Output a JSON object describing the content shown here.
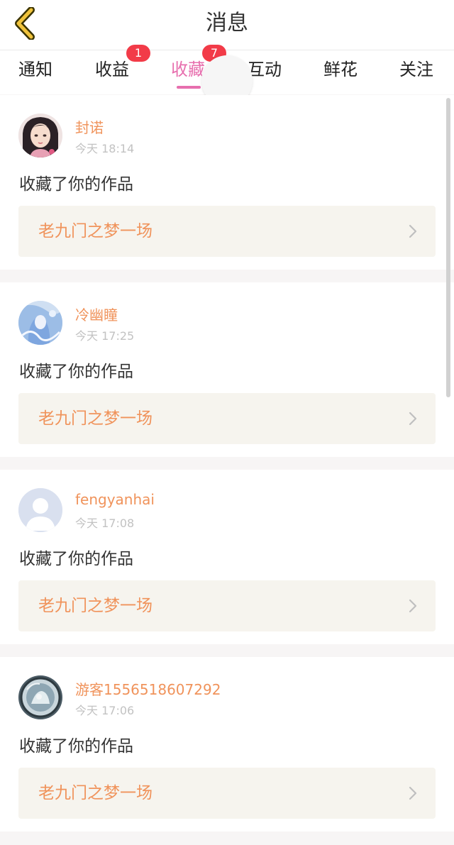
{
  "header": {
    "title": "消息",
    "back_icon": "chevron-left-icon",
    "back_icon_color": "#f0c33c"
  },
  "tabs": [
    {
      "label": "通知",
      "badge": ""
    },
    {
      "label": "收益",
      "badge": "1"
    },
    {
      "label": "收藏",
      "badge": "7",
      "active": true
    },
    {
      "label": "互动",
      "badge": ""
    },
    {
      "label": "鲜花",
      "badge": ""
    },
    {
      "label": "关注",
      "badge": ""
    }
  ],
  "colors": {
    "accent_pink": "#e76fae",
    "badge_red": "#f23b48",
    "name_orange": "#f0935b",
    "card_bg": "#f6f4ee"
  },
  "messages": [
    {
      "username": "封诺",
      "time": "今天 18:14",
      "action": "收藏了你的作品",
      "work_title": "老九门之梦一场",
      "avatar": "avatar-girl"
    },
    {
      "username": "冷幽瞳",
      "time": "今天 17:25",
      "action": "收藏了你的作品",
      "work_title": "老九门之梦一场",
      "avatar": "avatar-anime-blue"
    },
    {
      "username": "fengyanhai",
      "time": "今天 17:08",
      "action": "收藏了你的作品",
      "work_title": "老九门之梦一场",
      "avatar": "avatar-default"
    },
    {
      "username": "游客1556518607292",
      "time": "今天 17:06",
      "action": "收藏了你的作品",
      "work_title": "老九门之梦一场",
      "avatar": "avatar-anime-round"
    }
  ]
}
